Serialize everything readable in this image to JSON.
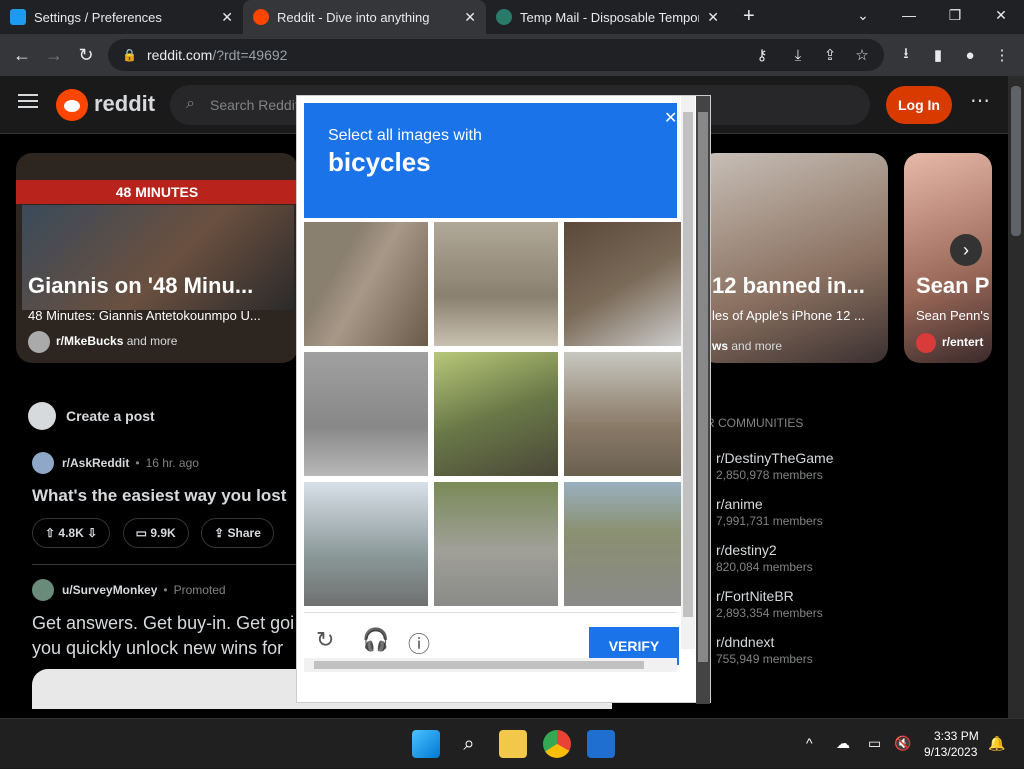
{
  "browser": {
    "tabs": [
      {
        "title": "Settings / Preferences",
        "active": false
      },
      {
        "title": "Reddit - Dive into anything",
        "active": true
      },
      {
        "title": "Temp Mail - Disposable Tempora",
        "active": false
      }
    ],
    "url_host": "reddit.com",
    "url_path": "/?rdt=49692"
  },
  "reddit": {
    "wordmark": "reddit",
    "search_placeholder": "Search Reddit",
    "login_label": "Log In",
    "cards": [
      {
        "headline": "Giannis on '48 Minu...",
        "subtitle": "48 Minutes: Giannis Antetokounmpo U...",
        "source": "r/MkeBucks",
        "more": "and more",
        "banner": "48 MINUTES"
      },
      {
        "headline": "12 banned in...",
        "subtitle": "les of Apple's iPhone 12 ...",
        "source": "ws",
        "more": "and more"
      },
      {
        "headline": "Sean P",
        "subtitle": "Sean Penn's",
        "source": "r/entert",
        "more": ""
      }
    ],
    "create_post": "Create a post",
    "posts": [
      {
        "sub": "r/AskReddit",
        "time": "16 hr. ago",
        "title": "What's the easiest way you lost",
        "votes": "4.8K",
        "comments": "9.9K",
        "share": "Share"
      },
      {
        "sub": "u/SurveyMonkey",
        "time": "Promoted",
        "title": "Get answers. Get buy-in. Get goi",
        "title2": "you quickly unlock new wins for"
      }
    ],
    "communities_header": "R COMMUNITIES",
    "communities": [
      {
        "name": "r/DestinyTheGame",
        "members": "2,850,978 members"
      },
      {
        "name": "r/anime",
        "members": "7,991,731 members"
      },
      {
        "name": "r/destiny2",
        "members": "820,084 members"
      },
      {
        "name": "r/FortNiteBR",
        "members": "2,893,354 members"
      },
      {
        "name": "r/dndnext",
        "members": "755,949 members"
      }
    ]
  },
  "captcha": {
    "instruction": "Select all images with",
    "target": "bicycles",
    "verify_label": "VERIFY"
  },
  "taskbar": {
    "time": "3:33 PM",
    "date": "9/13/2023"
  },
  "colors": {
    "reddit_orange": "#ff4500",
    "login_bg": "#d93a00",
    "captcha_blue": "#1a73e8"
  }
}
